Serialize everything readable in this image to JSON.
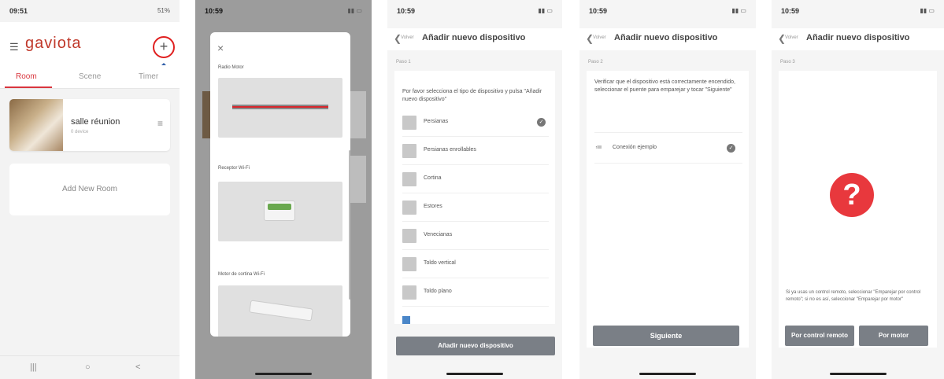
{
  "screen1": {
    "status_time": "09:51",
    "status_right": "51%",
    "logo": "gaviota",
    "plus_symbol": "+",
    "tabs": [
      "Room",
      "Scene",
      "Timer"
    ],
    "room_card": {
      "name": "salle réunion",
      "subtitle": "0 device"
    },
    "add_room": "Add New Room",
    "nav_buttons": [
      "|||",
      "○",
      "<"
    ],
    "accent_color": "#d9363e"
  },
  "screen2": {
    "status_time": "10:59",
    "close_symbol": "×",
    "sections": [
      "Radio Motor",
      "Receptor Wi-Fi",
      "Motor de cortina Wi-Fi"
    ]
  },
  "screen3": {
    "status_time": "10:59",
    "back_label": "Volver",
    "title": "Añadir nuevo dispositivo",
    "step": "Paso 1",
    "instruction": "Por favor selecciona el tipo de dispositivo y pulsa \"Añadir nuevo dispositivo\"",
    "devices": [
      "Persianas",
      "Persianas enrollables",
      "Cortina",
      "Estores",
      "Venecianas",
      "Toldo vertical",
      "Toldo plano"
    ],
    "selected_device": "Persianas",
    "button": "Añadir nuevo dispositivo"
  },
  "screen4": {
    "status_time": "10:59",
    "back_label": "Volver",
    "title": "Añadir nuevo dispositivo",
    "step": "Paso 2",
    "instruction": "Verificar que el dispositivo está correctamente encendido, seleccionar el puente para emparejar y tocar \"Siguiente\"",
    "bridge": "Conexión ejemplo",
    "button": "Siguiente"
  },
  "screen5": {
    "status_time": "10:59",
    "back_label": "Volver",
    "title": "Añadir nuevo dispositivo",
    "step": "Paso 3",
    "question_mark": "?",
    "instruction": "Si ya usas un control remoto, seleccionar \"Emparejar por control remoto\"; si no es así, seleccionar \"Emparejar por motor\"",
    "button_remote": "Por control remoto",
    "button_motor": "Por motor"
  }
}
